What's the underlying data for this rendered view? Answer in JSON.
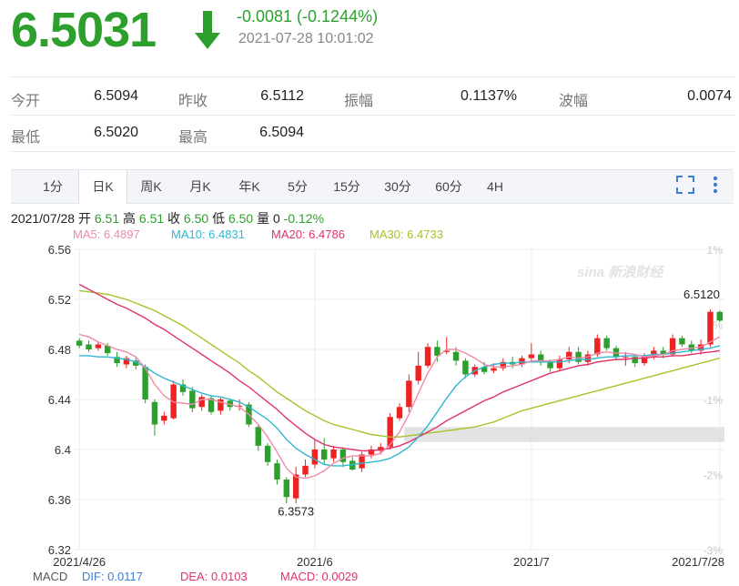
{
  "quote": {
    "price": "6.5031",
    "change": "-0.0081 (-0.1244%)",
    "timestamp": "2021-07-28 10:01:02"
  },
  "stats": {
    "open_label": "今开",
    "open_value": "6.5094",
    "prev_close_label": "昨收",
    "prev_close_value": "6.5112",
    "amplitude_label": "振幅",
    "amplitude_value": "0.1137%",
    "volatility_label": "波幅",
    "volatility_value": "0.0074",
    "low_label": "最低",
    "low_value": "6.5020",
    "high_label": "最高",
    "high_value": "6.5094"
  },
  "tabs": [
    "1分",
    "日K",
    "周K",
    "月K",
    "年K",
    "5分",
    "15分",
    "30分",
    "60分",
    "4H"
  ],
  "active_tab": "日K",
  "ohlc_line": {
    "date": "2021/07/28",
    "open_label": "开",
    "open": "6.51",
    "high_label": "高",
    "high": "6.51",
    "close_label": "收",
    "close": "6.50",
    "low_label": "低",
    "low": "6.50",
    "volume_label": "量",
    "volume": "0",
    "pct": "-0.12%"
  },
  "ma_legend": {
    "ma5": "MA5: 6.4897",
    "ma10": "MA10: 6.4831",
    "ma20": "MA20: 6.4786",
    "ma30": "MA30: 6.4733"
  },
  "macd_legend": {
    "label": "MACD",
    "dif": "DIF: 0.0117",
    "dea": "DEA: 0.0103",
    "macd": "MACD: 0.0029"
  },
  "watermark": "sina 新浪财经",
  "colors": {
    "up": "#ee2222",
    "down": "#2d9f2d",
    "ma5": "#f08aaa",
    "ma10": "#2fb8d0",
    "ma20": "#e0336a",
    "ma30": "#a8c22a"
  },
  "chart_data": {
    "type": "candlestick",
    "ylim": [
      6.32,
      6.56
    ],
    "yticks": [
      "6.56",
      "6.52",
      "6.48",
      "6.44",
      "6.4",
      "6.36",
      "6.32"
    ],
    "pct_ticks": [
      "1%",
      "0%",
      "-1%",
      "-2%",
      "-3%"
    ],
    "x_labels": [
      "2021/4/26",
      "2021/6",
      "2021/7",
      "2021/7/28"
    ],
    "x_label_index": [
      0,
      25,
      48,
      68
    ],
    "grid": true,
    "annotations": [
      {
        "text": "6.5120",
        "index": 68,
        "value": 6.512
      },
      {
        "text": "6.3573",
        "index": 23,
        "value": 6.3573
      }
    ],
    "candles": [
      [
        6.487,
        6.483,
        6.489,
        6.481
      ],
      [
        6.484,
        6.48,
        6.487,
        6.478
      ],
      [
        6.481,
        6.484,
        6.486,
        6.479
      ],
      [
        6.483,
        6.477,
        6.485,
        6.475
      ],
      [
        6.474,
        6.469,
        6.478,
        6.466
      ],
      [
        6.468,
        6.473,
        6.475,
        6.465
      ],
      [
        6.471,
        6.467,
        6.474,
        6.464
      ],
      [
        6.466,
        6.44,
        6.468,
        6.437
      ],
      [
        6.438,
        6.42,
        6.44,
        6.411
      ],
      [
        6.423,
        6.427,
        6.43,
        6.42
      ],
      [
        6.425,
        6.452,
        6.455,
        6.424
      ],
      [
        6.452,
        6.446,
        6.456,
        6.443
      ],
      [
        6.447,
        6.433,
        6.45,
        6.43
      ],
      [
        6.434,
        6.442,
        6.444,
        6.431
      ],
      [
        6.441,
        6.43,
        6.443,
        6.428
      ],
      [
        6.431,
        6.44,
        6.442,
        6.428
      ],
      [
        6.439,
        6.434,
        6.441,
        6.431
      ],
      [
        6.435,
        6.435,
        6.44,
        6.431
      ],
      [
        6.436,
        6.42,
        6.438,
        6.418
      ],
      [
        6.418,
        6.403,
        6.42,
        6.399
      ],
      [
        6.403,
        6.39,
        6.405,
        6.387
      ],
      [
        6.389,
        6.376,
        6.392,
        6.372
      ],
      [
        6.376,
        6.362,
        6.378,
        6.357
      ],
      [
        6.361,
        6.38,
        6.386,
        6.357
      ],
      [
        6.38,
        6.387,
        6.392,
        6.378
      ],
      [
        6.388,
        6.4,
        6.408,
        6.385
      ],
      [
        6.4,
        6.392,
        6.409,
        6.388
      ],
      [
        6.393,
        6.4,
        6.403,
        6.39
      ],
      [
        6.4,
        6.39,
        6.402,
        6.386
      ],
      [
        6.391,
        6.384,
        6.394,
        6.383
      ],
      [
        6.385,
        6.396,
        6.398,
        6.382
      ],
      [
        6.396,
        6.4,
        6.403,
        6.393
      ],
      [
        6.399,
        6.402,
        6.405,
        6.396
      ],
      [
        6.402,
        6.426,
        6.429,
        6.4
      ],
      [
        6.425,
        6.434,
        6.437,
        6.423
      ],
      [
        6.434,
        6.455,
        6.46,
        6.43
      ],
      [
        6.455,
        6.467,
        6.478,
        6.452
      ],
      [
        6.467,
        6.482,
        6.485,
        6.465
      ],
      [
        6.482,
        6.475,
        6.487,
        6.47
      ],
      [
        6.478,
        6.479,
        6.49,
        6.476
      ],
      [
        6.478,
        6.471,
        6.482,
        6.467
      ],
      [
        6.471,
        6.46,
        6.473,
        6.457
      ],
      [
        6.46,
        6.466,
        6.468,
        6.458
      ],
      [
        6.466,
        6.462,
        6.47,
        6.46
      ],
      [
        6.463,
        6.465,
        6.469,
        6.461
      ],
      [
        6.465,
        6.47,
        6.473,
        6.463
      ],
      [
        6.47,
        6.468,
        6.474,
        6.465
      ],
      [
        6.468,
        6.473,
        6.475,
        6.466
      ],
      [
        6.473,
        6.476,
        6.485,
        6.47
      ],
      [
        6.476,
        6.47,
        6.479,
        6.467
      ],
      [
        6.47,
        6.465,
        6.472,
        6.462
      ],
      [
        6.465,
        6.472,
        6.475,
        6.463
      ],
      [
        6.472,
        6.478,
        6.482,
        6.469
      ],
      [
        6.478,
        6.47,
        6.482,
        6.468
      ],
      [
        6.47,
        6.476,
        6.479,
        6.467
      ],
      [
        6.476,
        6.489,
        6.492,
        6.474
      ],
      [
        6.489,
        6.481,
        6.491,
        6.479
      ],
      [
        6.481,
        6.474,
        6.483,
        6.471
      ],
      [
        6.474,
        6.474,
        6.478,
        6.467
      ],
      [
        6.474,
        6.469,
        6.476,
        6.466
      ],
      [
        6.469,
        6.474,
        6.477,
        6.467
      ],
      [
        6.474,
        6.479,
        6.482,
        6.472
      ],
      [
        6.479,
        6.476,
        6.482,
        6.473
      ],
      [
        6.476,
        6.489,
        6.492,
        6.474
      ],
      [
        6.489,
        6.484,
        6.491,
        6.482
      ],
      [
        6.484,
        6.479,
        6.487,
        6.477
      ],
      [
        6.479,
        6.484,
        6.488,
        6.476
      ],
      [
        6.484,
        6.51,
        6.512,
        6.482
      ],
      [
        6.51,
        6.503,
        6.511,
        6.502
      ]
    ],
    "ma5": [
      6.492,
      6.49,
      6.486,
      6.483,
      6.48,
      6.478,
      6.474,
      6.465,
      6.452,
      6.443,
      6.438,
      6.437,
      6.436,
      6.44,
      6.44,
      6.438,
      6.436,
      6.434,
      6.428,
      6.42,
      6.41,
      6.398,
      6.385,
      6.378,
      6.377,
      6.379,
      6.383,
      6.389,
      6.393,
      6.395,
      6.395,
      6.395,
      6.397,
      6.404,
      6.414,
      6.428,
      6.445,
      6.461,
      6.474,
      6.48,
      6.48,
      6.477,
      6.473,
      6.468,
      6.466,
      6.466,
      6.467,
      6.468,
      6.471,
      6.471,
      6.471,
      6.472,
      6.474,
      6.473,
      6.474,
      6.477,
      6.478,
      6.477,
      6.477,
      6.476,
      6.474,
      6.475,
      6.476,
      6.479,
      6.48,
      6.481,
      6.482,
      6.486,
      6.49
    ],
    "ma10": [
      6.475,
      6.475,
      6.474,
      6.474,
      6.473,
      6.472,
      6.47,
      6.466,
      6.461,
      6.457,
      6.454,
      6.451,
      6.448,
      6.445,
      6.443,
      6.442,
      6.44,
      6.438,
      6.434,
      6.429,
      6.424,
      6.417,
      6.408,
      6.401,
      6.396,
      6.392,
      6.388,
      6.387,
      6.387,
      6.388,
      6.389,
      6.39,
      6.391,
      6.393,
      6.397,
      6.402,
      6.41,
      6.419,
      6.43,
      6.441,
      6.451,
      6.458,
      6.463,
      6.466,
      6.468,
      6.469,
      6.469,
      6.47,
      6.47,
      6.47,
      6.47,
      6.47,
      6.471,
      6.472,
      6.472,
      6.473,
      6.474,
      6.474,
      6.475,
      6.475,
      6.475,
      6.476,
      6.476,
      6.477,
      6.478,
      6.479,
      6.48,
      6.481,
      6.483
    ],
    "ma20": [
      6.532,
      6.528,
      6.524,
      6.52,
      6.516,
      6.513,
      6.509,
      6.505,
      6.5,
      6.496,
      6.491,
      6.486,
      6.481,
      6.476,
      6.471,
      6.466,
      6.461,
      6.455,
      6.45,
      6.444,
      6.438,
      6.432,
      6.425,
      6.419,
      6.413,
      6.408,
      6.404,
      6.402,
      6.401,
      6.4,
      6.399,
      6.399,
      6.4,
      6.401,
      6.403,
      6.406,
      6.41,
      6.414,
      6.418,
      6.423,
      6.427,
      6.431,
      6.435,
      6.439,
      6.442,
      6.446,
      6.449,
      6.452,
      6.455,
      6.458,
      6.461,
      6.463,
      6.465,
      6.467,
      6.468,
      6.47,
      6.471,
      6.472,
      6.472,
      6.473,
      6.473,
      6.474,
      6.474,
      6.475,
      6.475,
      6.476,
      6.477,
      6.478,
      6.479
    ],
    "ma30": [
      6.527,
      6.526,
      6.525,
      6.524,
      6.522,
      6.52,
      6.517,
      6.514,
      6.511,
      6.507,
      6.503,
      6.499,
      6.494,
      6.489,
      6.484,
      6.479,
      6.474,
      6.469,
      6.463,
      6.458,
      6.452,
      6.446,
      6.441,
      6.436,
      6.431,
      6.427,
      6.423,
      6.42,
      6.418,
      6.416,
      6.414,
      6.412,
      6.411,
      6.41,
      6.41,
      6.411,
      6.412,
      6.413,
      6.414,
      6.415,
      6.416,
      6.417,
      6.418,
      6.42,
      6.422,
      6.425,
      6.428,
      6.431,
      6.433,
      6.435,
      6.437,
      6.439,
      6.441,
      6.443,
      6.445,
      6.447,
      6.449,
      6.451,
      6.453,
      6.455,
      6.457,
      6.459,
      6.461,
      6.463,
      6.465,
      6.467,
      6.469,
      6.471,
      6.473
    ],
    "highlight_band": [
      6.406,
      6.418
    ]
  }
}
